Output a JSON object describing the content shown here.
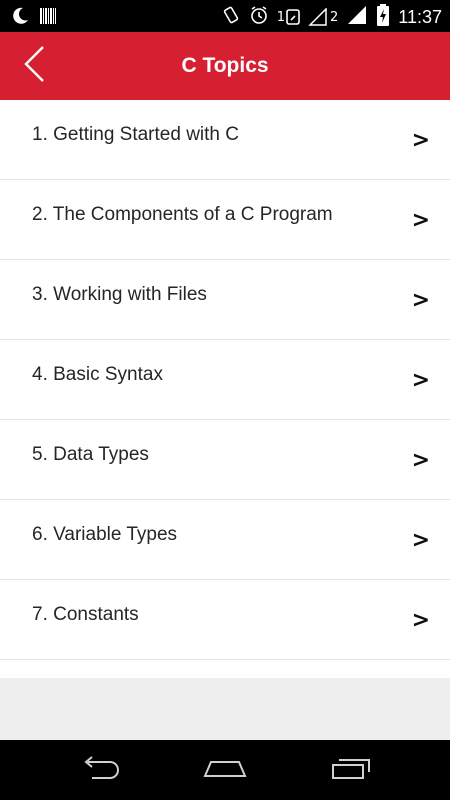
{
  "status_bar": {
    "time": "11:37",
    "icons": [
      "moon-icon",
      "barcode-icon",
      "vibrate-icon",
      "alarm-icon",
      "sim1-signal-icon",
      "sim2-signal-icon",
      "battery-charging-icon"
    ],
    "sim1_label": "1",
    "sim2_label": "2"
  },
  "app_bar": {
    "title": "C Topics",
    "background_color": "#d61f31"
  },
  "topics": [
    {
      "label": "1. Getting Started with C",
      "chevron": ">"
    },
    {
      "label": "2. The Components of a C Program",
      "chevron": ">"
    },
    {
      "label": "3. Working with Files",
      "chevron": ">"
    },
    {
      "label": "4. Basic Syntax",
      "chevron": ">"
    },
    {
      "label": "5. Data Types",
      "chevron": ">"
    },
    {
      "label": "6. Variable Types",
      "chevron": ">"
    },
    {
      "label": "7. Constants",
      "chevron": ">"
    }
  ],
  "nav_bar": {
    "icons": [
      "back-icon",
      "home-icon",
      "recent-apps-icon"
    ]
  }
}
